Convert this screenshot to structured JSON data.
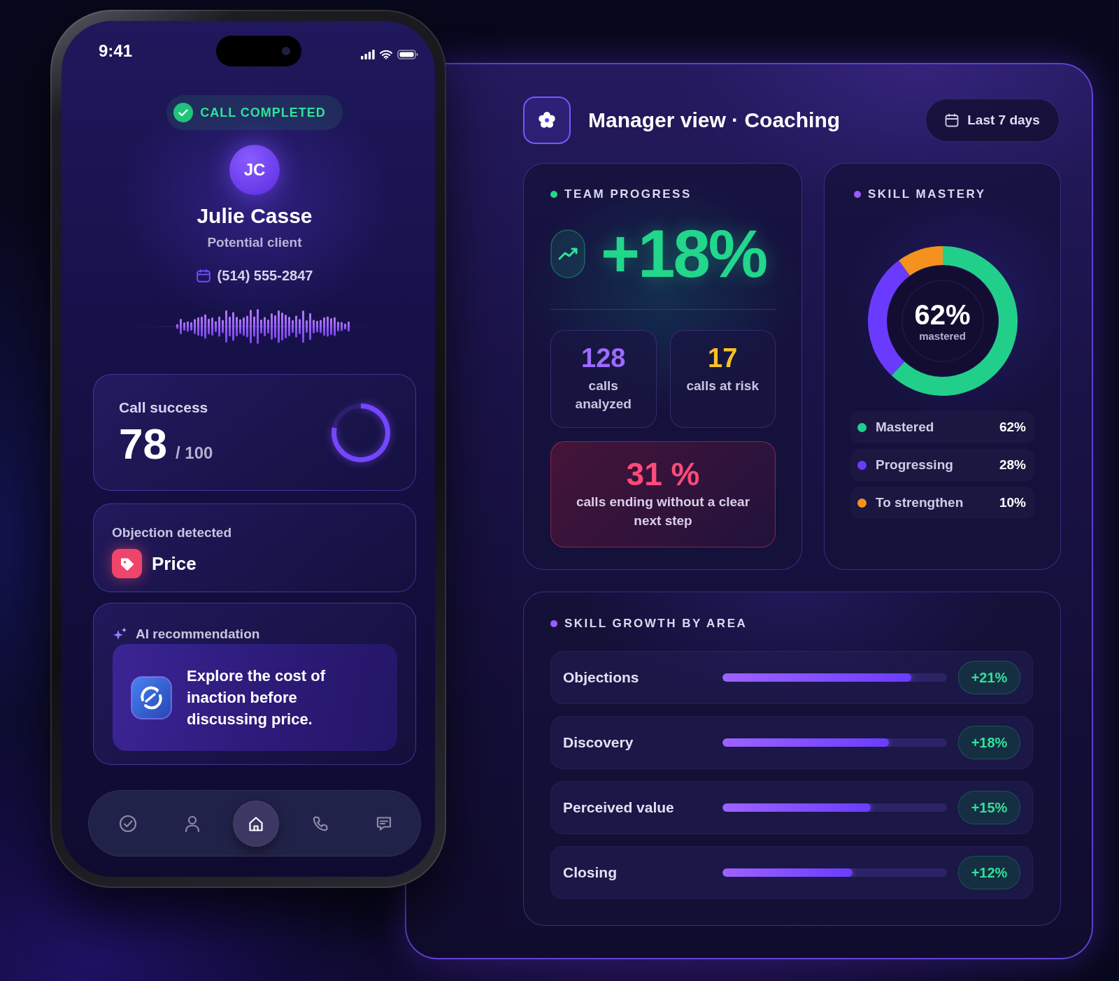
{
  "phone": {
    "status_bar": {
      "time": "9:41"
    },
    "call_status": "CALL COMPLETED",
    "contact": {
      "initials": "JC",
      "name": "Julie Casse",
      "role": "Potential client",
      "phone": "(514) 555-2847"
    },
    "call_success": {
      "label": "Call success",
      "score": "78",
      "max": "/ 100"
    },
    "objection": {
      "label": "Objection detected",
      "value": "Price"
    },
    "ai_recommendation": {
      "label": "AI recommendation",
      "text": "Explore the cost of inaction before discussing price."
    },
    "nav": [
      {
        "kind": "check",
        "selected": false
      },
      {
        "kind": "person",
        "selected": false
      },
      {
        "kind": "home",
        "selected": true
      },
      {
        "kind": "phone",
        "selected": false
      },
      {
        "kind": "chat",
        "selected": false
      }
    ]
  },
  "dashboard": {
    "title": "Manager view · Coaching",
    "period": "Last 7 days",
    "team_progress": {
      "title": "TEAM PROGRESS",
      "change": "+18%",
      "stats": [
        {
          "value": "128",
          "label": "calls analyzed",
          "color": "#9d6bff"
        },
        {
          "value": "17",
          "label": "calls at risk",
          "color": "#f7c325"
        }
      ],
      "alert": {
        "value": "31 %",
        "text": "calls ending without a clear next step"
      }
    },
    "skill_mastery": {
      "title": "SKILL MASTERY",
      "center_value": "62%",
      "center_label": "mastered",
      "chart_data": {
        "type": "donut",
        "categories": [
          "Mastered",
          "Progressing",
          "To strengthen"
        ],
        "values": [
          62,
          28,
          10
        ]
      },
      "legend": [
        {
          "value": "62%",
          "color": "#22cf8a"
        },
        {
          "value": "28%",
          "color": "#6a3bff"
        },
        {
          "value": "10%",
          "color": "#f5911e"
        }
      ]
    },
    "skill_growth": {
      "title": "SKILL GROWTH BY AREA",
      "rows": [
        {
          "label": "Objections",
          "level": 0.84,
          "change": "+21%"
        },
        {
          "label": "Discovery",
          "level": 0.74,
          "change": "+18%"
        },
        {
          "label": "Perceived value",
          "level": 0.66,
          "change": "+15%"
        },
        {
          "label": "Closing",
          "level": 0.58,
          "change": "+12%"
        }
      ]
    }
  }
}
